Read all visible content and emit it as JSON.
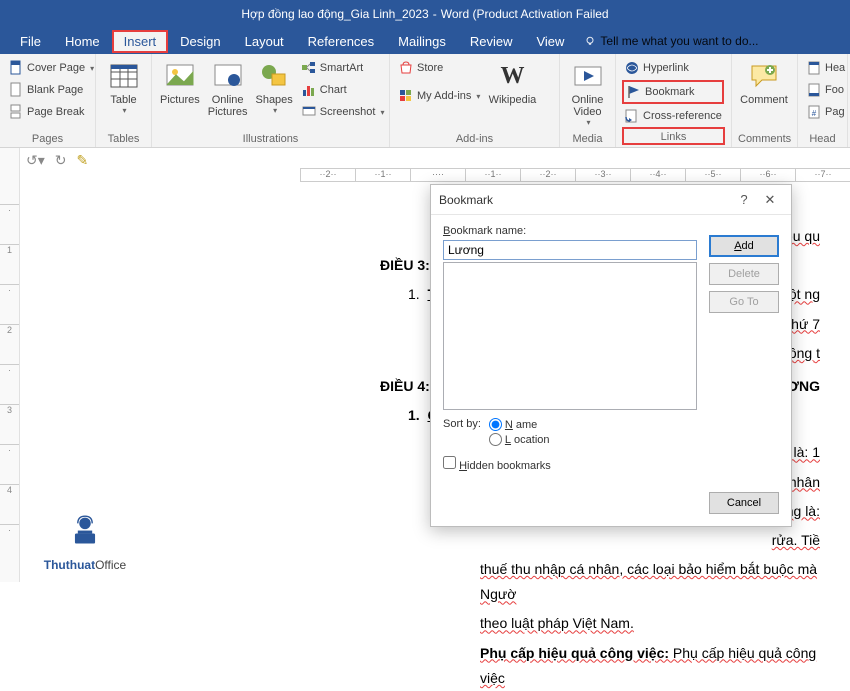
{
  "title": {
    "doc": "Hợp đồng lao động_Gia Linh_2023",
    "app": "Word",
    "status": "(Product Activation Failed"
  },
  "tabs": {
    "file": "File",
    "home": "Home",
    "insert": "Insert",
    "design": "Design",
    "layout": "Layout",
    "references": "References",
    "mailings": "Mailings",
    "review": "Review",
    "view": "View",
    "tellme": "Tell me what you want to do..."
  },
  "ribbon": {
    "pages": {
      "cover": "Cover Page",
      "blank": "Blank Page",
      "break": "Page Break",
      "label": "Pages"
    },
    "tables": {
      "table": "Table",
      "label": "Tables"
    },
    "illus": {
      "pictures": "Pictures",
      "online": "Online Pictures",
      "shapes": "Shapes",
      "smart": "SmartArt",
      "chart": "Chart",
      "screenshot": "Screenshot",
      "label": "Illustrations"
    },
    "addins": {
      "store": "Store",
      "my": "My Add-ins",
      "wiki": "Wikipedia",
      "label": "Add-ins"
    },
    "media": {
      "video": "Online Video",
      "label": "Media"
    },
    "links": {
      "hyper": "Hyperlink",
      "bookmark": "Bookmark",
      "cross": "Cross-reference",
      "label": "Links"
    },
    "comments": {
      "comment": "Comment",
      "label": "Comments"
    },
    "head": {
      "hea": "Hea",
      "foo": "Foo",
      "pag": "Pag",
      "label": "Head"
    }
  },
  "doc": {
    "dieu3": "ĐIỀU 3:",
    "line31a": "T",
    "line31b": "ờ một ng",
    "line32": "ết thứ 7 ",
    "line33": "ị Đông t",
    "dieu4": "ĐIỀU 4:",
    "dieu4r": "ƠNG",
    "line41": "C",
    "p1a": "ồng là: 1",
    "p1b": "cá nhân",
    "p2a": "ồng là:",
    "p2b": "rửa. Tiề",
    "p3": "thuế thu nhập cá nhân, các loại bảo hiểm bắt buộc mà Ngườ",
    "p4": "theo luật pháp Việt Nam.",
    "p5a": "Phụ cấp hiệu quả công việc:",
    "p5b": " Phụ cấp hiệu quả công việc",
    "topright": "hiệu qu"
  },
  "dialog": {
    "title": "Bookmark",
    "nameLabel": "Bookmark name:",
    "nameValue": "Lương",
    "add": "Add",
    "delete": "Delete",
    "goto": "Go To",
    "sortby": "Sort by:",
    "optName": "Name",
    "optLoc": "Location",
    "hidden": "Hidden bookmarks",
    "cancel": "Cancel"
  },
  "watermark": {
    "line1": "Thuthuat",
    "line2": "Office"
  }
}
